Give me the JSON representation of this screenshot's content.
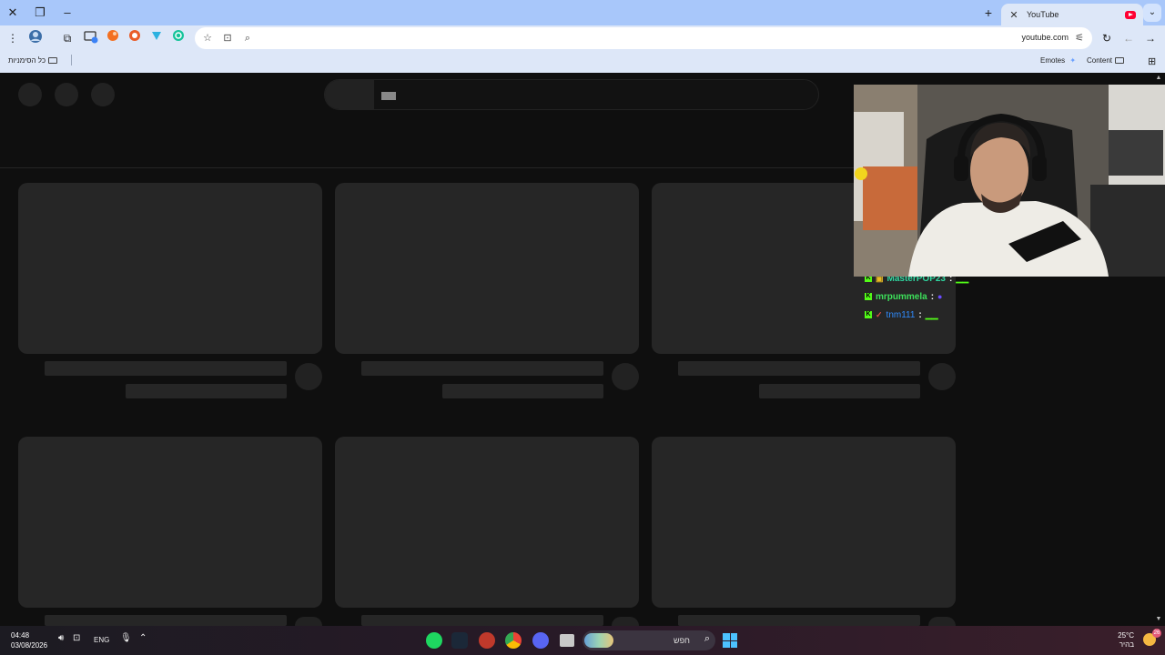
{
  "browser": {
    "tab_title": "YouTube",
    "new_tab": "+",
    "url": "youtube.com",
    "bookmarks": {
      "all_bookmarks": "כל הסימניות",
      "emotes": "Emotes",
      "content": "Content"
    }
  },
  "chat": {
    "messages": [
      {
        "user": "MasterPOP23",
        "sep": ":",
        "color": "#2fd7a1"
      },
      {
        "user": "mrpummela",
        "sep": ":",
        "color": "#3de05a"
      },
      {
        "user": "tnm111",
        "sep": ":",
        "color": "#2f8cff"
      }
    ]
  },
  "taskbar": {
    "time": "04:48",
    "date": "03/08/2026",
    "language": "ENG",
    "search_placeholder": "חפש",
    "temperature": "25°C",
    "weather_desc": "בהיר",
    "notifications": "26"
  },
  "colors": {
    "chrome_title": "#a8c7fa",
    "chrome_toolbar": "#dde7f8",
    "yt_bg": "#0f0f0f",
    "skeleton": "#262626",
    "kick_green": "#53fc18"
  }
}
